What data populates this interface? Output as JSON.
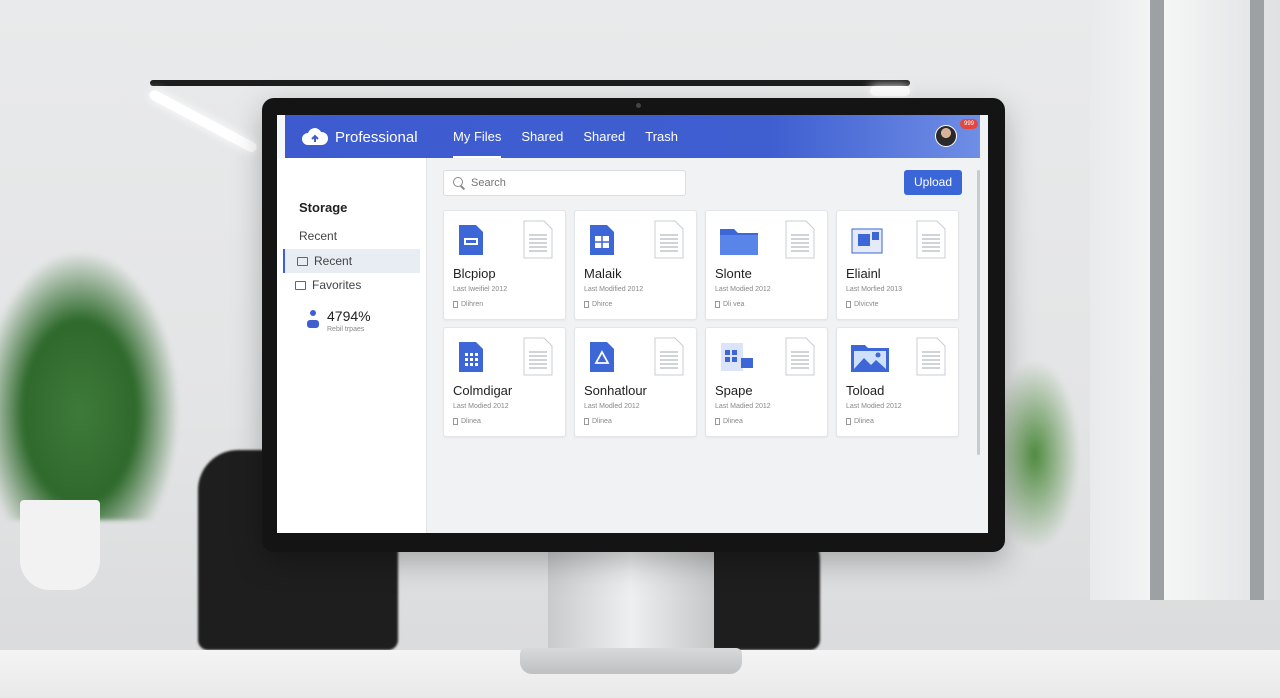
{
  "header": {
    "brand": "Professional",
    "nav": [
      "My Files",
      "Shared",
      "Shared",
      "Trash"
    ],
    "badge": "999"
  },
  "sidebar": {
    "title": "Storage",
    "recent_heading": "Recent",
    "items": [
      {
        "label": "Recent",
        "selected": true
      },
      {
        "label": "Favorites",
        "selected": false
      }
    ],
    "storage_value": "4794%",
    "storage_label": "Rebil trpaes"
  },
  "search": {
    "placeholder": "Search"
  },
  "upload_label": "Upload",
  "files": [
    {
      "name": "Blcpiop",
      "meta": "Last Iweifiel 2012",
      "owner": "Dlihren",
      "icon": "doc-icon"
    },
    {
      "name": "Malaik",
      "meta": "Last Modified 2012",
      "owner": "Dhirce",
      "icon": "sheet-icon"
    },
    {
      "name": "Slonte",
      "meta": "Last Modied 2012",
      "owner": "Dli vea",
      "icon": "folder-icon"
    },
    {
      "name": "Eliainl",
      "meta": "Last Morfied 2013",
      "owner": "Dlvicvte",
      "icon": "form-icon"
    },
    {
      "name": "Colmdigar",
      "meta": "Last Modied 2012",
      "owner": "Dlinea",
      "icon": "grid-doc-icon"
    },
    {
      "name": "Sonhatlour",
      "meta": "Last Modled 2012",
      "owner": "Dlinea",
      "icon": "drive-doc-icon"
    },
    {
      "name": "Spape",
      "meta": "Last Madied 2012",
      "owner": "Dlinea",
      "icon": "slides-icon"
    },
    {
      "name": "Toload",
      "meta": "Last Modied 2012",
      "owner": "Dlinea",
      "icon": "image-icon"
    }
  ],
  "colors": {
    "header_blue": "#3f5fd1",
    "upload_blue": "#3b66d8",
    "icon_blue": "#3d66d6",
    "badge_red": "#e3463f"
  }
}
